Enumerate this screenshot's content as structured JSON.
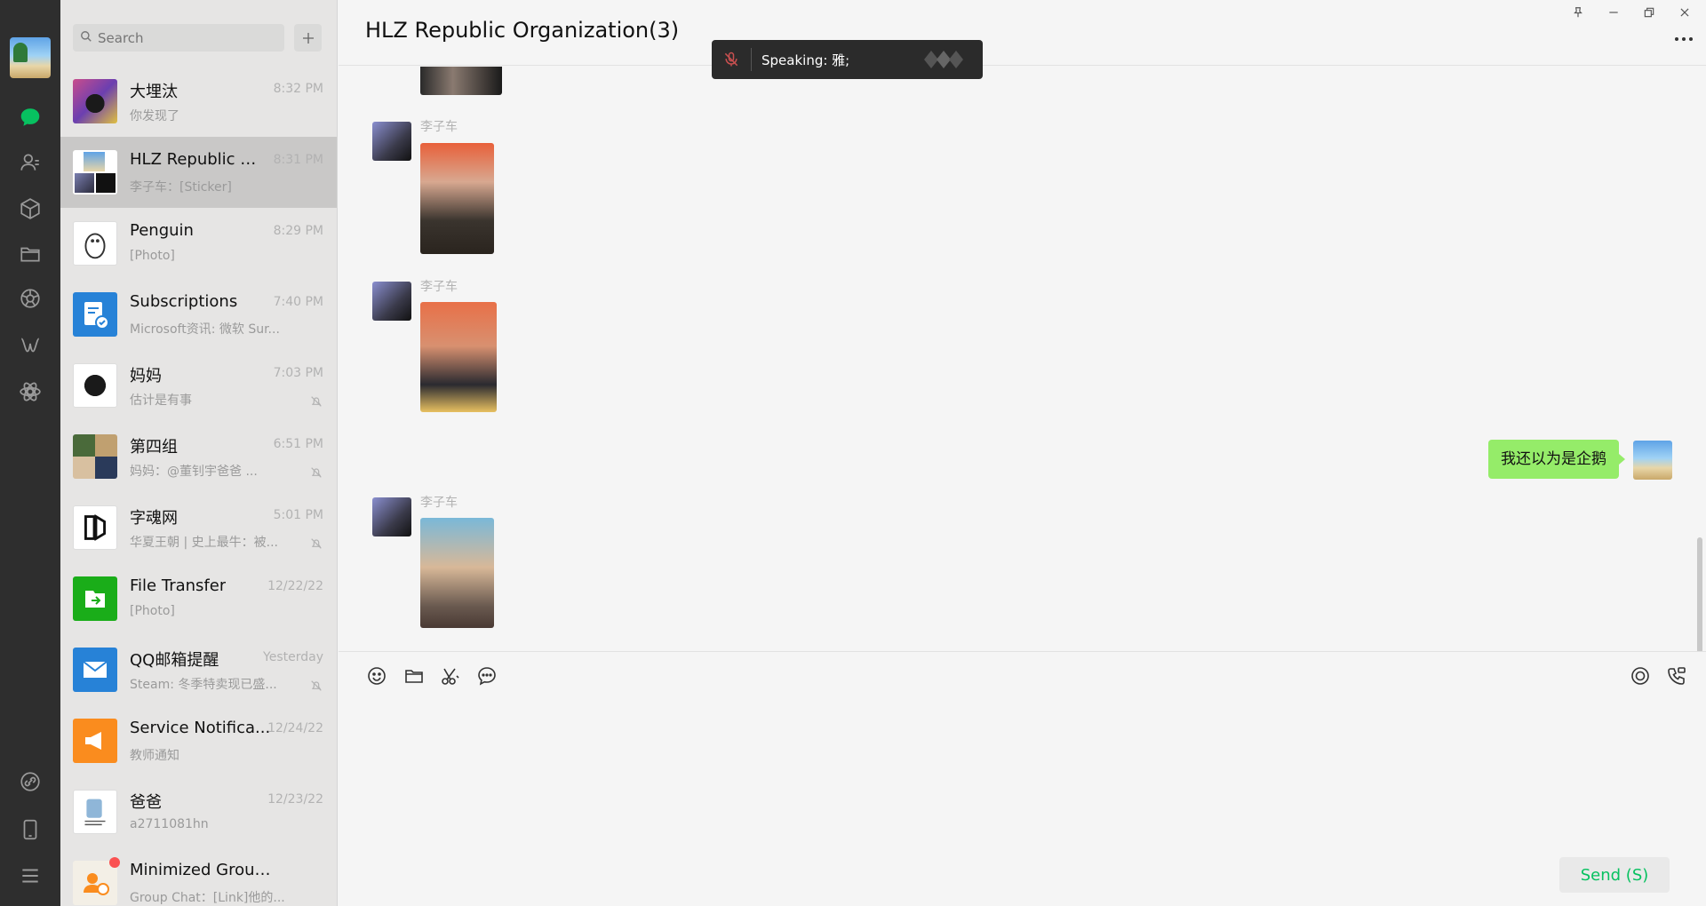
{
  "search": {
    "placeholder": "Search"
  },
  "conversations": [
    {
      "name": "大埋汰",
      "time": "8:32 PM",
      "preview": "你发现了",
      "muted": false
    },
    {
      "name": "HLZ Republic Or...",
      "time": "8:31 PM",
      "preview": "李子车：[Sticker]",
      "muted": false,
      "active": true
    },
    {
      "name": "Penguin",
      "time": "8:29 PM",
      "preview": "[Photo]",
      "muted": false
    },
    {
      "name": "Subscriptions",
      "time": "7:40 PM",
      "preview": "Microsoft资讯: 微软 Sur...",
      "muted": false
    },
    {
      "name": "妈妈",
      "time": "7:03 PM",
      "preview": "估计是有事",
      "muted": true
    },
    {
      "name": "第四组",
      "time": "6:51 PM",
      "preview": "妈妈：@董钊宇爸爸 ...",
      "muted": true
    },
    {
      "name": "字魂网",
      "time": "5:01 PM",
      "preview": "华夏王朝 | 史上最牛：被...",
      "muted": true
    },
    {
      "name": "File Transfer",
      "time": "12/22/22",
      "preview": "[Photo]",
      "muted": false
    },
    {
      "name": "QQ邮箱提醒",
      "time": "Yesterday",
      "preview": "Steam: 冬季特卖现已盛...",
      "muted": true
    },
    {
      "name": "Service Notifica...",
      "time": "12/24/22",
      "preview": "教师通知",
      "muted": false
    },
    {
      "name": "爸爸",
      "time": "12/23/22",
      "preview": "a2711081hn",
      "muted": false
    },
    {
      "name": "Minimized Groups",
      "time": "",
      "preview": "Group Chat：[Link]他的...",
      "muted": false,
      "unread_dot": true
    }
  ],
  "chat": {
    "title": "HLZ Republic Organization(3)",
    "speaking": "Speaking: 雅;",
    "messages": [
      {
        "sender": "李子车",
        "type": "photo"
      },
      {
        "sender": "李子车",
        "type": "photo"
      },
      {
        "sender": "",
        "type": "text",
        "outgoing": true,
        "text": "我还以为是企鹅"
      },
      {
        "sender": "李子车",
        "type": "photo"
      }
    ]
  },
  "composer": {
    "send_label": "Send (S)"
  },
  "icons": {
    "rail": [
      "chat-icon",
      "contacts-icon",
      "favorites-icon",
      "folder-icon",
      "moments-icon",
      "channels-icon",
      "mini-programs-icon",
      "link-icon",
      "phone-icon",
      "menu-icon"
    ],
    "toolbar": [
      "emoji-icon",
      "file-icon",
      "screenshot-icon",
      "chat-history-icon",
      "live-icon",
      "call-icon"
    ]
  },
  "colors": {
    "accent": "#07c160",
    "bubble": "#95ec69",
    "rail": "#2e2e2e"
  }
}
